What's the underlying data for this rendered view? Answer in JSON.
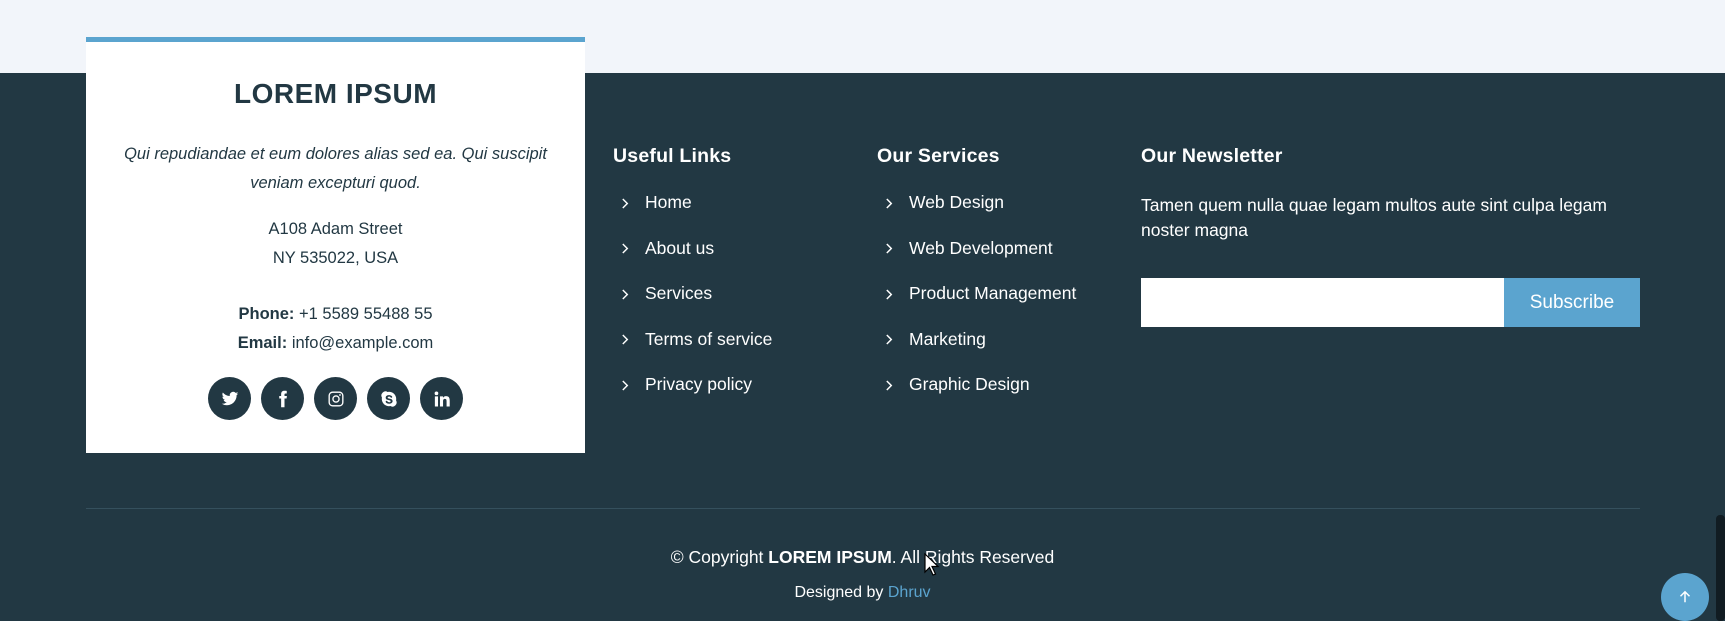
{
  "card": {
    "title": "LOREM IPSUM",
    "description": "Qui repudiandae et eum dolores alias sed ea. Qui suscipit veniam excepturi quod.",
    "address_line1": "A108 Adam Street",
    "address_line2": "NY 535022, USA",
    "phone_label": "Phone:",
    "phone": "+1 5589 55488 55",
    "email_label": "Email:",
    "email": "info@example.com",
    "socials": [
      "twitter-icon",
      "facebook-icon",
      "instagram-icon",
      "skype-icon",
      "linkedin-icon"
    ]
  },
  "useful_links": {
    "heading": "Useful Links",
    "items": [
      "Home",
      "About us",
      "Services",
      "Terms of service",
      "Privacy policy"
    ]
  },
  "services": {
    "heading": "Our Services",
    "items": [
      "Web Design",
      "Web Development",
      "Product Management",
      "Marketing",
      "Graphic Design"
    ]
  },
  "newsletter": {
    "heading": "Our Newsletter",
    "description": "Tamen quem nulla quae legam multos aute sint culpa legam noster magna",
    "input_value": "",
    "button_label": "Subscribe"
  },
  "footer": {
    "copyright_prefix": "© Copyright",
    "brand": "LOREM IPSUM",
    "copyright_suffix": ". All Rights Reserved",
    "designed_by": "Designed by",
    "designer": "Dhruv"
  },
  "colors": {
    "accent": "#5ba4cf",
    "footer_bg": "#223843",
    "page_bg": "#f2f5fa"
  }
}
